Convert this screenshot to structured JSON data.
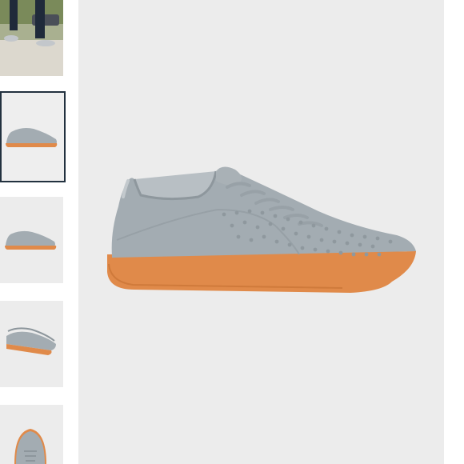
{
  "gallery": {
    "selected_index": 1,
    "thumbnails": [
      {
        "icon": "lifestyle-photo-icon"
      },
      {
        "icon": "shoe-side-view-icon"
      },
      {
        "icon": "shoe-side-view-icon"
      },
      {
        "icon": "shoe-top-angle-icon"
      },
      {
        "icon": "shoe-top-view-icon"
      }
    ]
  },
  "colors": {
    "upper": "#a3acb2",
    "sole": "#e08a4a",
    "background": "#ececec",
    "selected_border": "#22313f"
  }
}
